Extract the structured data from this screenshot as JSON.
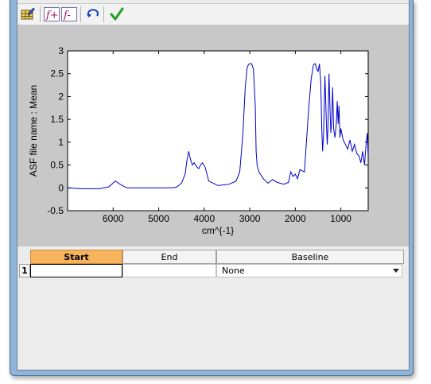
{
  "toolbar": {
    "buttons": [
      {
        "name": "edit-table-icon"
      },
      {
        "name": "add-formula-icon",
        "label": "f+"
      },
      {
        "name": "remove-formula-icon",
        "label": "f-"
      },
      {
        "name": "undo-icon"
      },
      {
        "name": "checkmark-icon"
      }
    ]
  },
  "chart_data": {
    "type": "line",
    "xlabel": "cm^{-1}",
    "ylabel": "ASF file name : Mean",
    "xlim": [
      7000,
      400
    ],
    "ylim": [
      -0.5,
      3
    ],
    "x_reversed": true,
    "xticks": [
      6000,
      5000,
      4000,
      3000,
      2000,
      1000
    ],
    "yticks": [
      -0.5,
      0,
      0.5,
      1,
      1.5,
      2,
      2.5,
      3
    ],
    "series": [
      {
        "color": "#0000c8",
        "x": [
          7000,
          6700,
          6300,
          6100,
          5950,
          5850,
          5700,
          5300,
          4900,
          4700,
          4600,
          4500,
          4420,
          4380,
          4340,
          4300,
          4260,
          4220,
          4180,
          4120,
          4080,
          4040,
          3980,
          3900,
          3700,
          3450,
          3300,
          3220,
          3150,
          3100,
          3060,
          3030,
          3000,
          2960,
          2920,
          2880,
          2860,
          2840,
          2800,
          2700,
          2600,
          2500,
          2400,
          2250,
          2150,
          2100,
          2050,
          2000,
          1950,
          1900,
          1800,
          1750,
          1700,
          1650,
          1600,
          1560,
          1530,
          1500,
          1470,
          1440,
          1420,
          1400,
          1380,
          1350,
          1320,
          1300,
          1280,
          1260,
          1240,
          1220,
          1200,
          1180,
          1160,
          1130,
          1100,
          1080,
          1060,
          1040,
          1020,
          1000,
          950,
          900,
          850,
          800,
          750,
          700,
          650,
          600,
          560,
          520,
          480,
          450,
          420,
          400
        ],
        "y": [
          0,
          -0.02,
          -0.02,
          0.02,
          0.15,
          0.08,
          0.0,
          0.0,
          0.0,
          0.0,
          0.02,
          0.1,
          0.3,
          0.6,
          0.8,
          0.62,
          0.5,
          0.55,
          0.48,
          0.42,
          0.5,
          0.55,
          0.45,
          0.15,
          0.05,
          0.08,
          0.15,
          0.35,
          1.2,
          2.2,
          2.62,
          2.7,
          2.72,
          2.72,
          2.6,
          1.8,
          0.8,
          0.5,
          0.35,
          0.2,
          0.1,
          0.18,
          0.12,
          0.08,
          0.12,
          0.35,
          0.25,
          0.3,
          0.2,
          0.4,
          0.35,
          1.1,
          1.8,
          2.4,
          2.7,
          2.72,
          2.6,
          2.55,
          2.72,
          2.3,
          1.3,
          0.8,
          1.2,
          2.45,
          1.5,
          0.95,
          1.4,
          2.5,
          1.8,
          1.2,
          1.5,
          2.2,
          1.3,
          1.1,
          1.4,
          1.9,
          1.4,
          1.8,
          1.1,
          1.3,
          1.05,
          0.95,
          0.85,
          1.05,
          0.8,
          0.95,
          0.75,
          0.7,
          0.55,
          0.8,
          0.5,
          0.9,
          1.2,
          0.7
        ]
      }
    ]
  },
  "table": {
    "columns": [
      {
        "label": "Start"
      },
      {
        "label": "End"
      },
      {
        "label": "Baseline"
      }
    ],
    "rows": [
      {
        "index": "1",
        "start": "",
        "end": "",
        "baseline": "None"
      }
    ]
  }
}
